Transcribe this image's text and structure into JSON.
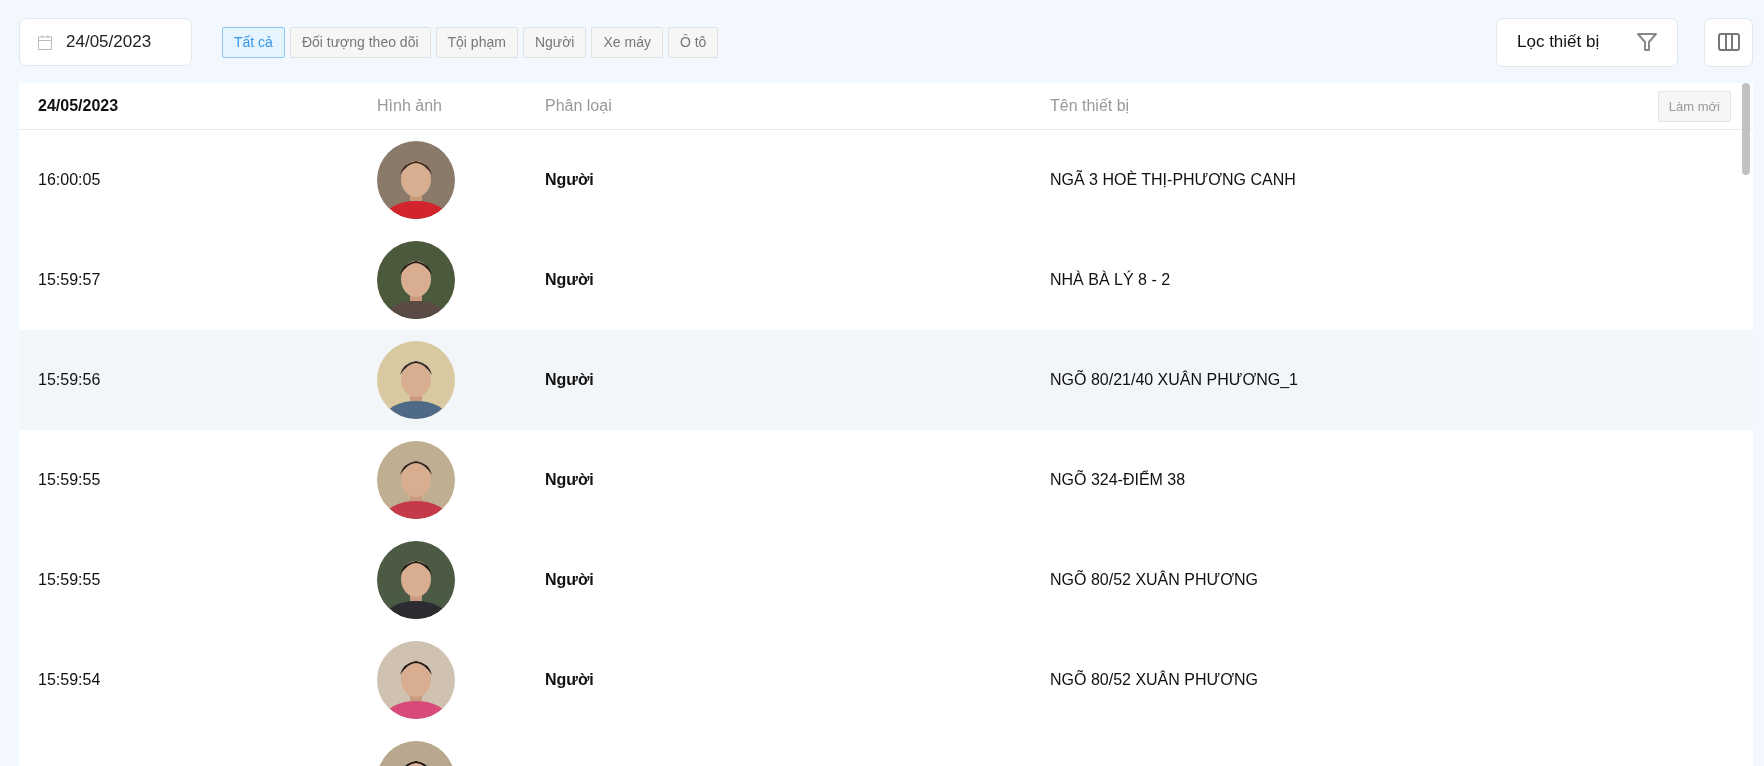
{
  "date_picker": {
    "value": "24/05/2023"
  },
  "filters": [
    {
      "label": "Tất cả",
      "selected": true
    },
    {
      "label": "Đối tượng theo dõi",
      "selected": false
    },
    {
      "label": "Tội phạm",
      "selected": false
    },
    {
      "label": "Người",
      "selected": false
    },
    {
      "label": "Xe máy",
      "selected": false
    },
    {
      "label": "Ô tô",
      "selected": false
    }
  ],
  "device_filter": {
    "label": "Lọc thiết bị"
  },
  "table": {
    "columns": [
      "24/05/2023",
      "Hình ảnh",
      "Phân loại",
      "Tên thiết bị"
    ],
    "refresh_button": "Làm mới",
    "rows": [
      {
        "time": "16:00:05",
        "category": "Người",
        "device": "NGÃ 3 HOÈ THỊ-PHƯƠNG CANH",
        "selected": false
      },
      {
        "time": "15:59:57",
        "category": "Người",
        "device": "NHÀ BÀ LÝ 8 - 2",
        "selected": false
      },
      {
        "time": "15:59:56",
        "category": "Người",
        "device": "NGÕ 80/21/40 XUÂN PHƯƠNG_1",
        "selected": true
      },
      {
        "time": "15:59:55",
        "category": "Người",
        "device": "NGÕ 324-ĐIỂM 38",
        "selected": false
      },
      {
        "time": "15:59:55",
        "category": "Người",
        "device": "NGÕ 80/52 XUÂN PHƯƠNG",
        "selected": false
      },
      {
        "time": "15:59:54",
        "category": "Người",
        "device": "NGÕ 80/52 XUÂN PHƯƠNG",
        "selected": false
      },
      {
        "selected": false
      }
    ]
  }
}
